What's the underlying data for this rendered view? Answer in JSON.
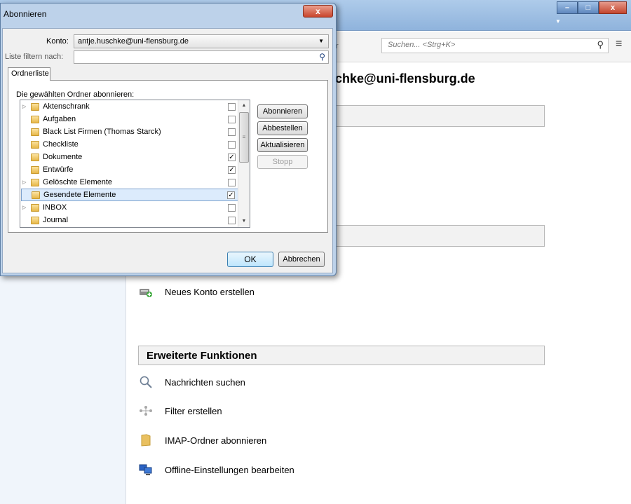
{
  "app": {
    "window_controls": {
      "minimize": "–",
      "maximize": "□",
      "close": "x"
    },
    "search": {
      "placeholder": "Suchen... <Strg+K>"
    },
    "toolbar_fragment": "r",
    "account_heading": "chke@uni-flensburg.de",
    "actions_top": [
      {
        "icon": "new-account-icon",
        "label": "Neues Konto erstellen"
      }
    ],
    "advanced": {
      "title": "Erweiterte Funktionen",
      "actions": [
        {
          "icon": "search-icon",
          "label": "Nachrichten suchen"
        },
        {
          "icon": "filter-icon",
          "label": "Filter erstellen"
        },
        {
          "icon": "folder-icon",
          "label": "IMAP-Ordner abonnieren"
        },
        {
          "icon": "offline-icon",
          "label": "Offline-Einstellungen bearbeiten"
        }
      ]
    }
  },
  "dialog": {
    "title": "Abonnieren",
    "close": "x",
    "konto_label": "Konto:",
    "konto_value": "antje.huschke@uni-flensburg.de",
    "filter_label": "Liste filtern nach:",
    "filter_value": "",
    "tab_label": "Ordnerliste",
    "subscribe_label": "Die gewählten Ordner abonnieren:",
    "folders": [
      {
        "name": "Aktenschrank",
        "expandable": true,
        "checked": false,
        "selected": false
      },
      {
        "name": "Aufgaben",
        "expandable": false,
        "checked": false,
        "selected": false
      },
      {
        "name": "Black List Firmen (Thomas Starck)",
        "expandable": false,
        "checked": false,
        "selected": false
      },
      {
        "name": "Checkliste",
        "expandable": false,
        "checked": false,
        "selected": false
      },
      {
        "name": "Dokumente",
        "expandable": false,
        "checked": true,
        "selected": false
      },
      {
        "name": "Entwürfe",
        "expandable": false,
        "checked": true,
        "selected": false
      },
      {
        "name": "Gelöschte Elemente",
        "expandable": true,
        "checked": false,
        "selected": false
      },
      {
        "name": "Gesendete Elemente",
        "expandable": false,
        "checked": true,
        "selected": true
      },
      {
        "name": "INBOX",
        "expandable": true,
        "checked": false,
        "selected": false
      },
      {
        "name": "Journal",
        "expandable": false,
        "checked": false,
        "selected": false
      }
    ],
    "buttons": {
      "subscribe": "Abonnieren",
      "unsubscribe": "Abbestellen",
      "refresh": "Aktualisieren",
      "stop": "Stopp",
      "ok": "OK",
      "cancel": "Abbrechen"
    }
  }
}
